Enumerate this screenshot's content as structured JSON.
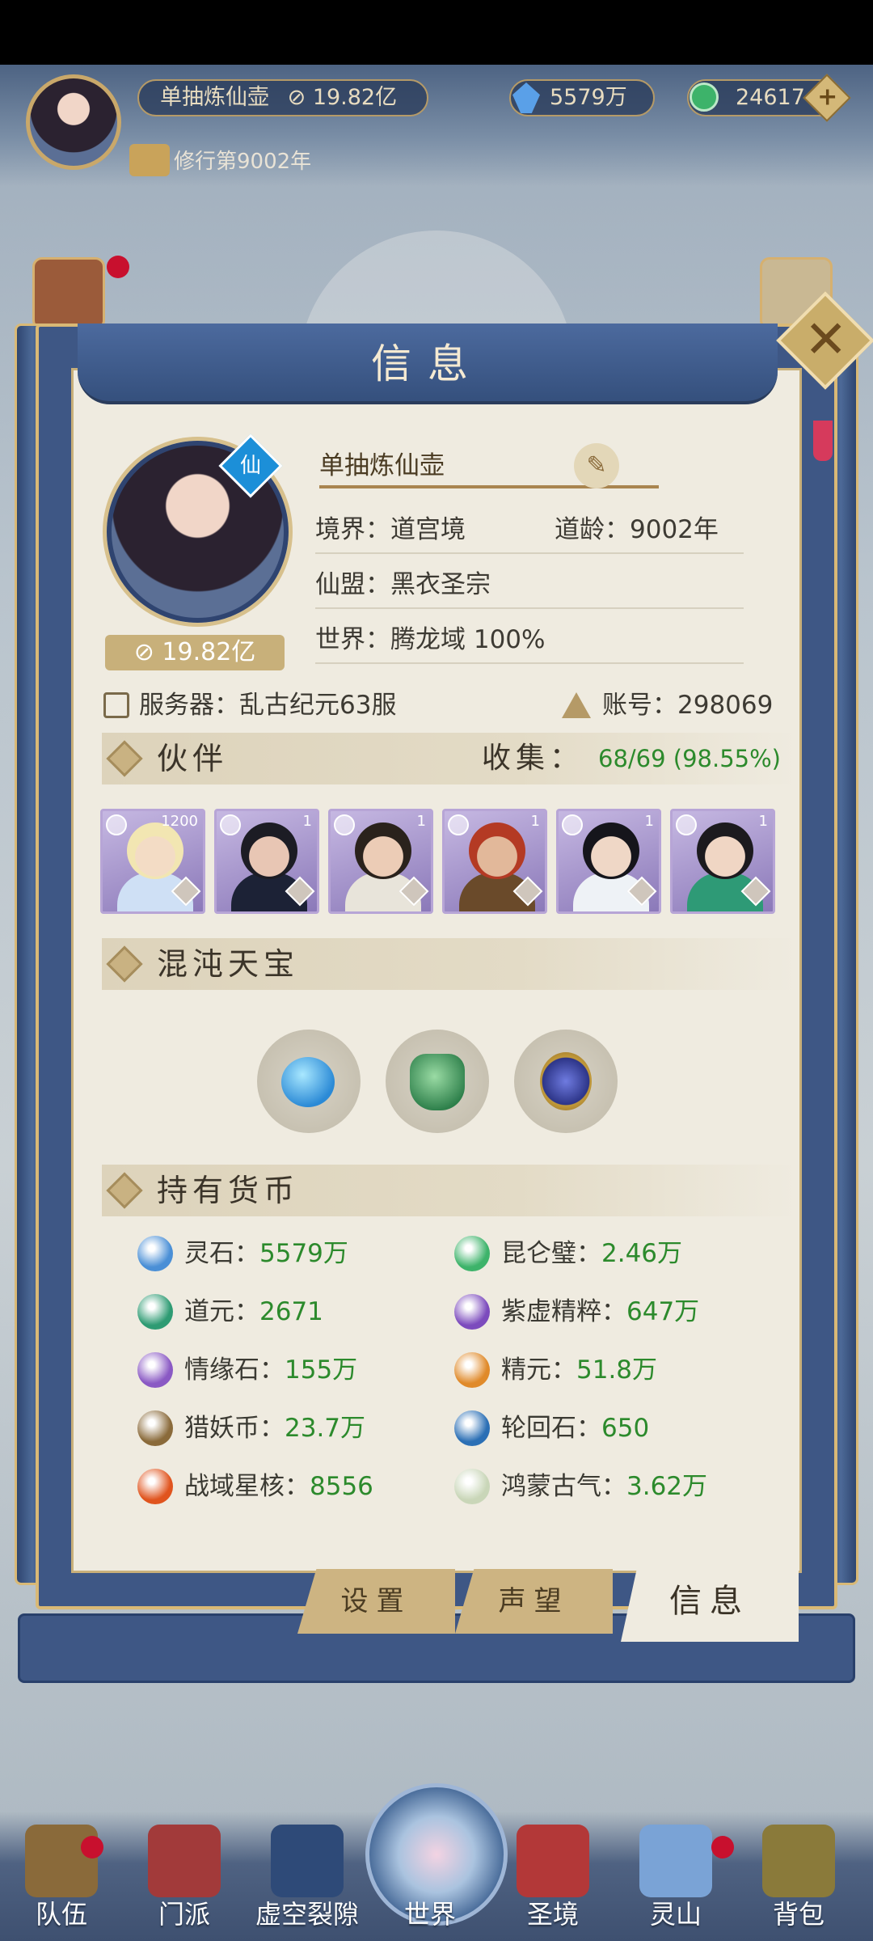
{
  "hud": {
    "player_name": "单抽炼仙壶",
    "power": "19.82亿",
    "year_text": "修行第9002年",
    "spirit_stones": "5579万",
    "jade": "24617",
    "plus_label": "+"
  },
  "panel": {
    "title": "信息",
    "close_label": "✕"
  },
  "profile": {
    "name": "单抽炼仙壶",
    "power": "19.82亿",
    "sect_badge": "仙",
    "realm": "境界：道宫境",
    "age": "道龄：9002年",
    "alliance": "仙盟：黑衣圣宗",
    "world": "世界：腾龙域  100%",
    "server": "服务器：乱古纪元63服",
    "account": "账号：298069"
  },
  "partners": {
    "title": "伙伴",
    "collect_label": "收集：",
    "collect_value": "68/69 (98.55%)",
    "items": [
      {
        "level": "1200"
      },
      {
        "level": "1"
      },
      {
        "level": "1"
      },
      {
        "level": "1"
      },
      {
        "level": "1"
      },
      {
        "level": "1"
      }
    ]
  },
  "treasures": {
    "title": "混沌天宝"
  },
  "currency": {
    "title": "持有货币",
    "items": [
      {
        "label": "灵石：",
        "value": "5579万",
        "icon": "blue-crystal-icon",
        "color": "#4a8fd6"
      },
      {
        "label": "昆仑璧：",
        "value": "2.46万",
        "icon": "jade-disc-icon",
        "color": "#3db36a"
      },
      {
        "label": "道元：",
        "value": "2671",
        "icon": "green-gem-icon",
        "color": "#2e9b73"
      },
      {
        "label": "紫虚精粹：",
        "value": "647万",
        "icon": "purple-crystal-icon",
        "color": "#7c4bbd"
      },
      {
        "label": "情缘石：",
        "value": "155万",
        "icon": "purple-stone-icon",
        "color": "#8a59c4"
      },
      {
        "label": "精元：",
        "value": "51.8万",
        "icon": "essence-orb-icon",
        "color": "#e08a2a"
      },
      {
        "label": "猎妖币：",
        "value": "23.7万",
        "icon": "bronze-coin-icon",
        "color": "#8a6a3a"
      },
      {
        "label": "轮回石：",
        "value": "650",
        "icon": "yin-yang-icon",
        "color": "#2b6fb5"
      },
      {
        "label": "战域星核：",
        "value": "8556",
        "icon": "star-core-icon",
        "color": "#e0541e"
      },
      {
        "label": "鸿蒙古气：",
        "value": "3.62万",
        "icon": "mist-icon",
        "color": "#c9d6b8"
      }
    ]
  },
  "tabs": {
    "settings": "设置",
    "reputation": "声望",
    "info": "信息"
  },
  "nav": {
    "items": [
      "队伍",
      "门派",
      "虚空裂隙",
      "世界",
      "圣境",
      "灵山",
      "背包"
    ]
  }
}
